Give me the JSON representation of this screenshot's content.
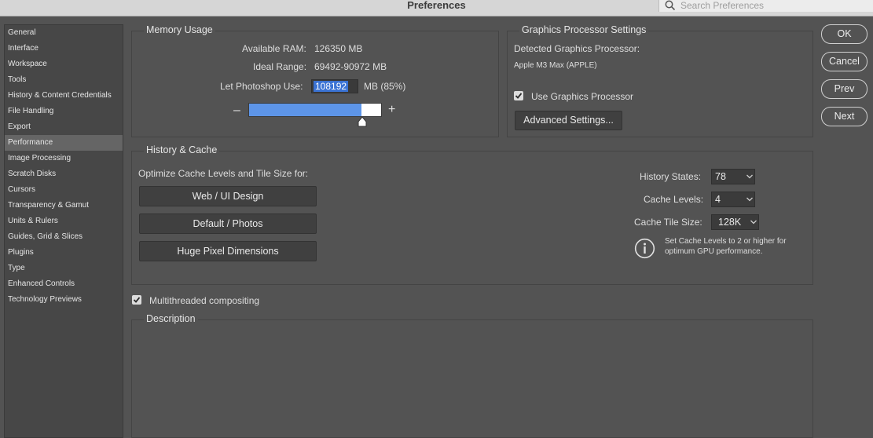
{
  "window": {
    "title": "Preferences"
  },
  "search": {
    "placeholder": "Search Preferences",
    "icon": "search-icon"
  },
  "sidebar": {
    "selected_index": 7,
    "items": [
      {
        "label": "General"
      },
      {
        "label": "Interface"
      },
      {
        "label": "Workspace"
      },
      {
        "label": "Tools"
      },
      {
        "label": "History & Content Credentials"
      },
      {
        "label": "File Handling"
      },
      {
        "label": "Export"
      },
      {
        "label": "Performance"
      },
      {
        "label": "Image Processing"
      },
      {
        "label": "Scratch Disks"
      },
      {
        "label": "Cursors"
      },
      {
        "label": "Transparency & Gamut"
      },
      {
        "label": "Units & Rulers"
      },
      {
        "label": "Guides, Grid & Slices"
      },
      {
        "label": "Plugins"
      },
      {
        "label": "Type"
      },
      {
        "label": "Enhanced Controls"
      },
      {
        "label": "Technology Previews"
      }
    ]
  },
  "memory": {
    "title": "Memory Usage",
    "available_label": "Available RAM:",
    "available_value": "126350 MB",
    "ideal_label": "Ideal Range:",
    "ideal_value": "69492-90972 MB",
    "use_label": "Let Photoshop Use:",
    "use_value": "108192",
    "use_suffix": "MB (85%)",
    "minus": "–",
    "plus": "+",
    "slider_fraction": 0.85
  },
  "gpu": {
    "title": "Graphics Processor Settings",
    "detected_label": "Detected Graphics Processor:",
    "detected_value": "Apple M3 Max (APPLE)",
    "use_gpu_label": "Use Graphics Processor",
    "use_gpu_checked": true,
    "advanced_button": "Advanced Settings..."
  },
  "history": {
    "title": "History & Cache",
    "optimize_label": "Optimize Cache Levels and Tile Size for:",
    "buttons": [
      "Web / UI Design",
      "Default / Photos",
      "Huge Pixel Dimensions"
    ],
    "states_label": "History States:",
    "states_value": "78",
    "levels_label": "Cache Levels:",
    "levels_value": "4",
    "tile_label": "Cache Tile Size:",
    "tile_value": "128K",
    "info_line1": "Set Cache Levels to 2 or higher for",
    "info_line2": "optimum GPU performance."
  },
  "multithread": {
    "label": "Multithreaded compositing",
    "checked": true
  },
  "description": {
    "title": "Description"
  },
  "actions": {
    "ok": "OK",
    "cancel": "Cancel",
    "prev": "Prev",
    "next": "Next"
  }
}
